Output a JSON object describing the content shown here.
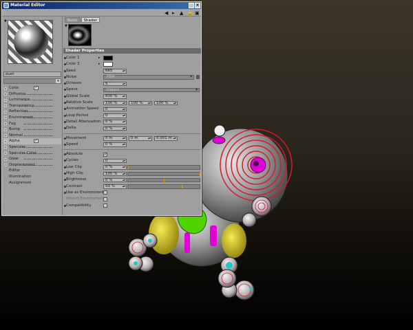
{
  "window": {
    "title": "Material Editor",
    "toolbar_icons": [
      "arrow-left-icon",
      "arrow-right-icon",
      "arrow-up-icon",
      "lock-icon",
      "panel-icon"
    ]
  },
  "material": {
    "name": "duet"
  },
  "channels": [
    {
      "label": "Color",
      "checked": true,
      "has_check": true
    },
    {
      "label": "Diffusion",
      "checked": false,
      "has_check": false
    },
    {
      "label": "Luminance",
      "checked": false,
      "has_check": false
    },
    {
      "label": "Transparency",
      "checked": false,
      "has_check": false
    },
    {
      "label": "Reflection",
      "checked": false,
      "has_check": false
    },
    {
      "label": "Environment",
      "checked": false,
      "has_check": false
    },
    {
      "label": "Fog",
      "checked": false,
      "has_check": false
    },
    {
      "label": "Bump",
      "checked": false,
      "has_check": false
    },
    {
      "label": "Normal",
      "checked": false,
      "has_check": false
    },
    {
      "label": "Alpha",
      "checked": true,
      "has_check": true
    },
    {
      "label": "Specular",
      "checked": false,
      "has_check": false
    },
    {
      "label": "Specular Color",
      "checked": false,
      "has_check": false
    },
    {
      "label": "Glow",
      "checked": false,
      "has_check": false
    },
    {
      "label": "Displacement",
      "checked": false,
      "has_check": false
    }
  ],
  "sub_items": [
    "Editor",
    "Illumination",
    "Assignment"
  ],
  "tabs": [
    "Basic",
    "Shader"
  ],
  "shader": {
    "header": "Shader Properties",
    "color1": "Color 1",
    "color2": "Color 2",
    "seed_label": "Seed",
    "seed": "665",
    "noise_label": "Noise",
    "noise": "FBM",
    "octaves_label": "Octaves",
    "octaves": "5",
    "space_label": "Space",
    "space": "Object",
    "global_scale_label": "Global Scale",
    "global_scale": "800 %",
    "relative_scale_label": "Relative Scale",
    "relative_scale": [
      "100 %",
      "100 %",
      "100 %"
    ],
    "anim_speed_label": "Animation Speed",
    "anim_speed": "0",
    "loop_period_label": "Loop Period",
    "loop_period": "0",
    "detail_label": "Detail Attenuation",
    "detail": "0 %",
    "delta_label": "Delta",
    "delta": "0 %",
    "movement_label": "Movement",
    "movement": [
      "0 m",
      "0 m",
      "0.001 m"
    ],
    "speed_label": "Speed",
    "speed": "0 %",
    "absolute_label": "Absolute",
    "cycles_label": "Cycles",
    "cycles": "0",
    "low_clip_label": "Low Clip",
    "low_clip": "0 %",
    "low_clip_value": 0,
    "high_clip_label": "High Clip",
    "high_clip": "100 %",
    "high_clip_value": 100,
    "brightness_label": "Brightness",
    "brightness": "0 %",
    "brightness_value": 50,
    "contrast_label": "Contrast",
    "contrast": "50 %",
    "contrast_value": 75,
    "use_env_label": "Use as Environment",
    "proj_env_label": "Project Environment",
    "compat_label": "Compatibility"
  },
  "colors": {
    "title_bar": "#0a246a",
    "panel": "#9e9e9e",
    "header": "#6b6b6b",
    "slider_marker": "#f2a000",
    "robot_magenta": "#e100d6",
    "robot_green": "#4fd400",
    "robot_yellow": "#e3d21c",
    "robot_cyan": "#1fc8c8"
  }
}
